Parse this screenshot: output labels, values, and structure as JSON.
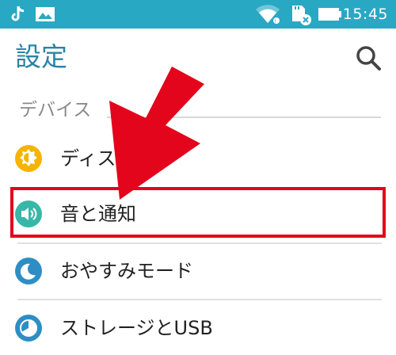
{
  "status_bar": {
    "time": "15:45",
    "color": "#29a8c4",
    "left_icons": [
      "tiktok-icon",
      "gallery-icon"
    ],
    "right_icons": [
      "wifi-icon",
      "sd-card-icon",
      "battery-icon"
    ]
  },
  "header": {
    "title": "設定",
    "search_icon": "search-icon",
    "accent_color": "#2a84a5"
  },
  "section": {
    "title": "デバイス"
  },
  "rows": [
    {
      "label": "ディスプレイ",
      "icon": "brightness-icon",
      "icon_color": "#f5b400",
      "visible_label": "ディス"
    },
    {
      "label": "音と通知",
      "icon": "speaker-icon",
      "icon_color": "#37b7a8",
      "highlighted": true
    },
    {
      "label": "おやすみモード",
      "icon": "moon-icon",
      "icon_color": "#2e8ec4"
    },
    {
      "label": "ストレージとUSB",
      "icon": "storage-icon",
      "icon_color": "#2e8ec4"
    }
  ],
  "annotation": {
    "highlight_color": "#e3051b",
    "arrow_color": "#e3051b"
  }
}
